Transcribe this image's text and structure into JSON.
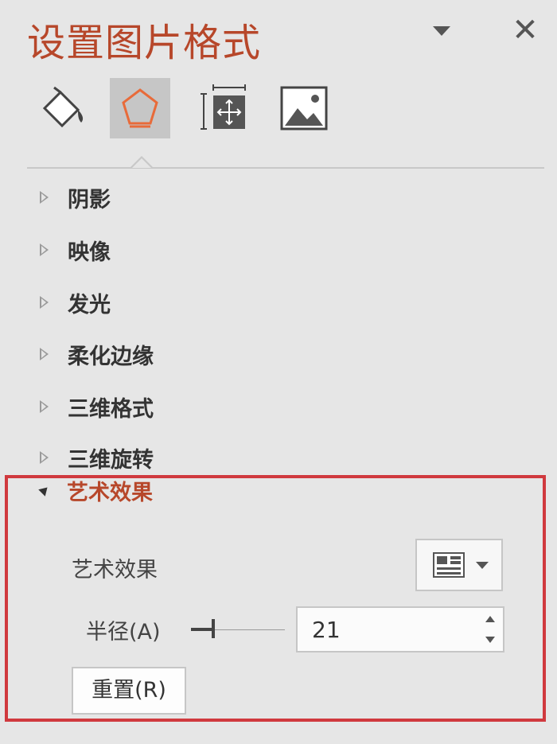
{
  "panel": {
    "title": "设置图片格式",
    "close_symbol": "✕"
  },
  "tabs": [
    {
      "name": "fill-line",
      "icon": "paint-bucket-icon",
      "active": false
    },
    {
      "name": "effects",
      "icon": "pentagon-icon",
      "active": true
    },
    {
      "name": "size-properties",
      "icon": "size-position-icon",
      "active": false
    },
    {
      "name": "picture",
      "icon": "picture-icon",
      "active": false
    }
  ],
  "sections": {
    "shadow": "阴影",
    "reflection": "映像",
    "glow": "发光",
    "soft_edges": "柔化边缘",
    "format_3d": "三维格式",
    "rotation_3d": "三维旋转",
    "artistic_effects": "艺术效果"
  },
  "artistic": {
    "effect_label": "艺术效果",
    "radius_label": "半径(A)",
    "radius_value": "21",
    "reset_label": "重置(R)"
  },
  "colors": {
    "accent": "#b7472a",
    "highlight_border": "#d0393e",
    "background": "#e6e6e6"
  }
}
